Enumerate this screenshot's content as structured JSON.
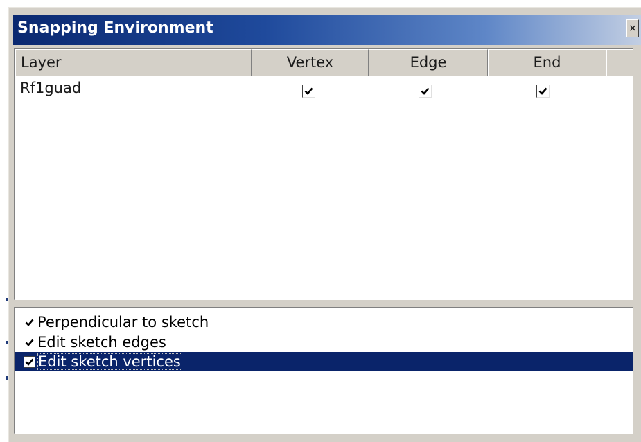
{
  "window": {
    "title": "Snapping Environment",
    "close_symbol": "×"
  },
  "table": {
    "columns": [
      "Layer",
      "Vertex",
      "Edge",
      "End"
    ],
    "rows": [
      {
        "layer": "Rf1guad",
        "vertex": true,
        "edge": true,
        "end": true
      }
    ]
  },
  "options": [
    {
      "label": "Perpendicular to sketch",
      "checked": true,
      "selected": false
    },
    {
      "label": "Edit sketch edges",
      "checked": true,
      "selected": false
    },
    {
      "label": "Edit sketch vertices",
      "checked": true,
      "selected": true
    }
  ],
  "colors": {
    "title_gradient_start": "#0a2870",
    "title_gradient_end": "#c3cfe3",
    "selection": "#0a246a",
    "dialog_background": "#d4d0c8"
  },
  "icons": {
    "close": "close-icon",
    "check": "checkmark-icon"
  }
}
